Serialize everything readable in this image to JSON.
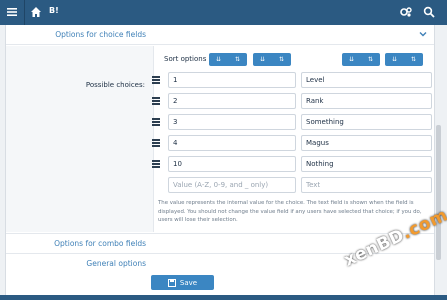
{
  "topbar": {
    "brand": "B!"
  },
  "sections": {
    "choice_fields": "Options for choice fields",
    "combo_fields": "Options for combo fields",
    "general": "General options"
  },
  "form": {
    "possible_choices_label": "Possible choices:",
    "sort_label": "Sort options",
    "sort_buttons": [
      {
        "glyph_a": "⇊",
        "glyph_b": "⇅"
      },
      {
        "glyph_a": "⇊",
        "glyph_b": "⇅"
      },
      {
        "glyph_a": "⇊",
        "glyph_b": "⇅"
      },
      {
        "glyph_a": "⇊",
        "glyph_b": "⇅"
      }
    ],
    "choices": [
      {
        "value": "1",
        "text": "Level"
      },
      {
        "value": "2",
        "text": "Rank"
      },
      {
        "value": "3",
        "text": "Something"
      },
      {
        "value": "4",
        "text": "Magus"
      },
      {
        "value": "10",
        "text": "Nothing"
      }
    ],
    "new_value_placeholder": "Value (A-Z, 0-9, and _ only)",
    "new_text_placeholder": "Text",
    "note": "The value represents the internal value for the choice. The text field is shown when the field is displayed. You should not change the value field if any users have selected that choice; if you do, users will lose their selection.",
    "save_label": "Save"
  },
  "watermark": {
    "part1": "xenBD",
    "part2": ".com"
  },
  "colors": {
    "topbar": "#2b5a82",
    "accent": "#3b86c2",
    "link": "#3f80b7"
  }
}
